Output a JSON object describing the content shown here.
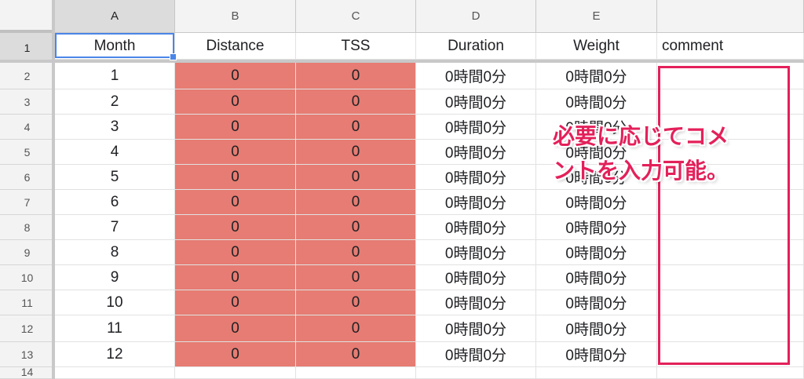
{
  "colors": {
    "highlight_fill": "#e67c73",
    "annotation": "#e3205a",
    "selection": "#4a86e8"
  },
  "column_letters": [
    "A",
    "B",
    "C",
    "D",
    "E",
    ""
  ],
  "header_row": {
    "number": "1",
    "cells": [
      "Month",
      "Distance",
      "TSS",
      "Duration",
      "Weight",
      "comment"
    ]
  },
  "rows": [
    {
      "num": "2",
      "cells": [
        "1",
        "0",
        "0",
        "0時間0分",
        "0時間0分",
        ""
      ]
    },
    {
      "num": "3",
      "cells": [
        "2",
        "0",
        "0",
        "0時間0分",
        "0時間0分",
        ""
      ]
    },
    {
      "num": "4",
      "cells": [
        "3",
        "0",
        "0",
        "0時間0分",
        "0時間0分",
        ""
      ]
    },
    {
      "num": "5",
      "cells": [
        "4",
        "0",
        "0",
        "0時間0分",
        "0時間0分",
        ""
      ]
    },
    {
      "num": "6",
      "cells": [
        "5",
        "0",
        "0",
        "0時間0分",
        "0時間0分",
        ""
      ]
    },
    {
      "num": "7",
      "cells": [
        "6",
        "0",
        "0",
        "0時間0分",
        "0時間0分",
        ""
      ]
    },
    {
      "num": "8",
      "cells": [
        "7",
        "0",
        "0",
        "0時間0分",
        "0時間0分",
        ""
      ]
    },
    {
      "num": "9",
      "cells": [
        "8",
        "0",
        "0",
        "0時間0分",
        "0時間0分",
        ""
      ]
    },
    {
      "num": "10",
      "cells": [
        "9",
        "0",
        "0",
        "0時間0分",
        "0時間0分",
        ""
      ]
    },
    {
      "num": "11",
      "cells": [
        "10",
        "0",
        "0",
        "0時間0分",
        "0時間0分",
        ""
      ]
    },
    {
      "num": "12",
      "cells": [
        "11",
        "0",
        "0",
        "0時間0分",
        "0時間0分",
        ""
      ]
    },
    {
      "num": "13",
      "cells": [
        "12",
        "0",
        "0",
        "0時間0分",
        "0時間0分",
        ""
      ]
    }
  ],
  "partial_row_number": "14",
  "annotation_text": "必要に応じてコメ\nントを入力可能。"
}
